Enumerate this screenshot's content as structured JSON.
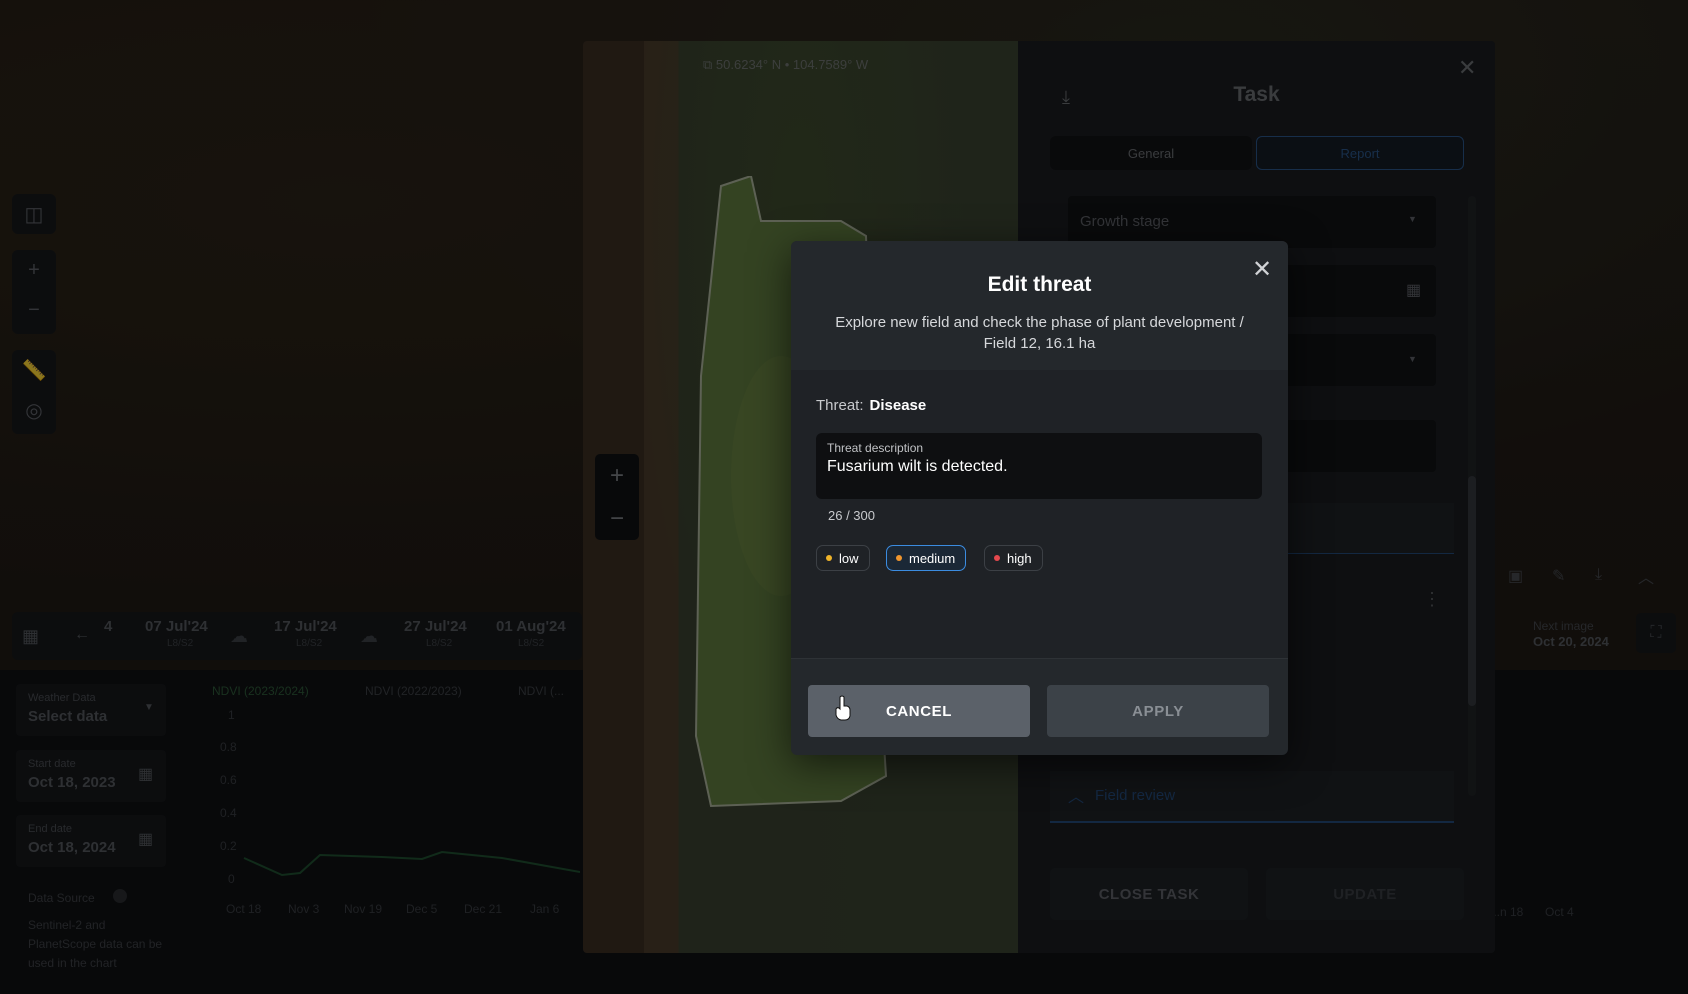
{
  "background": {
    "timeline": {
      "count": "4",
      "dates": [
        {
          "date": "07 Jul'24",
          "sub": "L8/S2"
        },
        {
          "date": "17 Jul'24",
          "sub": "L8/S2"
        },
        {
          "date": "27 Jul'24",
          "sub": "L8/S2"
        },
        {
          "date": "01 Aug'24",
          "sub": "L8/S2"
        }
      ]
    },
    "filters": {
      "weather_label": "Weather Data",
      "weather_value": "Select data",
      "start_label": "Start date",
      "start_value": "Oct 18, 2023",
      "end_label": "End date",
      "end_value": "Oct 18, 2024",
      "source_label": "Data Source",
      "source_text": "Sentinel-2 and PlanetScope data can be used in the chart"
    },
    "chart": {
      "legend": [
        "NDVI (2023/2024)",
        "NDVI (2022/2023)",
        "NDVI (..."
      ],
      "y_ticks": [
        "1",
        "0.8",
        "0.6",
        "0.4",
        "0.2",
        "0"
      ],
      "x_ticks": [
        "Oct 18",
        "Nov 3",
        "Nov 19",
        "Dec 5",
        "Dec 21",
        "Jan 6"
      ]
    },
    "right_chart": {
      "next_image_label": "Next image",
      "next_image_date": "Oct 20, 2024",
      "x_ticks": [
        "...n 18",
        "Oct 4"
      ]
    }
  },
  "task": {
    "coords": "50.6234° N • 104.7589° W",
    "title": "Task",
    "tabs": [
      "General",
      "Report"
    ],
    "growth_stage": "Growth stage",
    "field_review": "Field review",
    "close_task": "CLOSE TASK",
    "update": "UPDATE"
  },
  "dialog": {
    "title": "Edit threat",
    "subtitle": "Explore new field and check the phase of plant development / Field 12, 16.1 ha",
    "threat_label": "Threat:",
    "threat_value": "Disease",
    "description_label": "Threat description",
    "description_value": "Fusarium wilt is detected.",
    "char_count": "26 / 300",
    "severity": [
      {
        "label": "low",
        "color": "#f0b429",
        "selected": false
      },
      {
        "label": "medium",
        "color": "#f0962e",
        "selected": true
      },
      {
        "label": "high",
        "color": "#e5484d",
        "selected": false
      }
    ],
    "cancel": "CANCEL",
    "apply": "APPLY"
  },
  "colors": {
    "accent": "#2f7fd6",
    "cancel_bg": "#5b6169",
    "apply_bg": "#3c4248"
  }
}
